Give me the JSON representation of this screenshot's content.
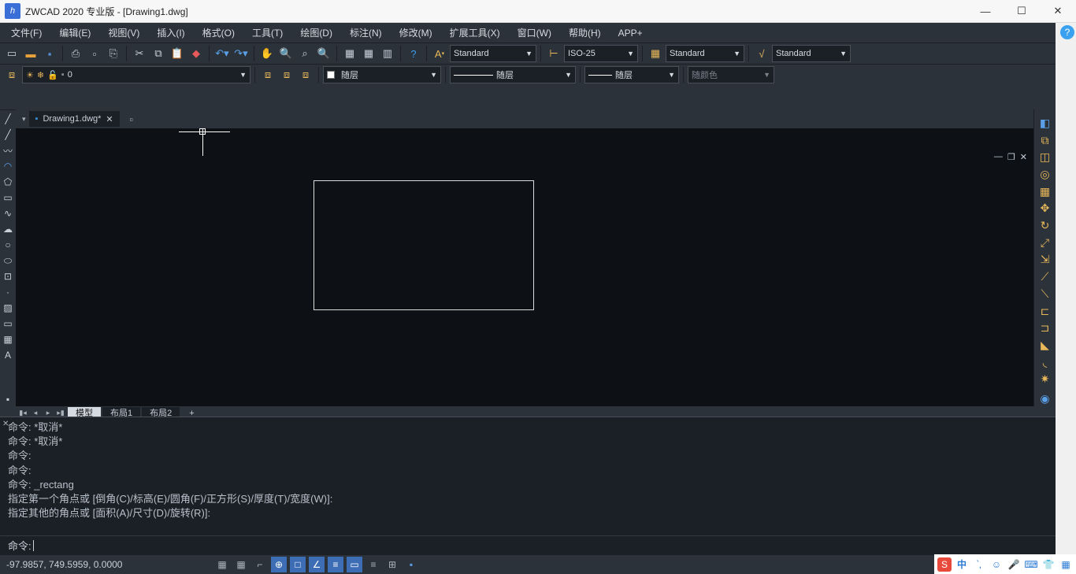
{
  "titlebar": {
    "app": "ZWCAD 2020 专业版 - [Drawing1.dwg]"
  },
  "menu": [
    "文件(F)",
    "编辑(E)",
    "视图(V)",
    "插入(I)",
    "格式(O)",
    "工具(T)",
    "绘图(D)",
    "标注(N)",
    "修改(M)",
    "扩展工具(X)",
    "窗口(W)",
    "帮助(H)",
    "APP+"
  ],
  "styles": {
    "text": "Standard",
    "dim": "ISO-25",
    "table": "Standard",
    "mleader": "Standard"
  },
  "layer": {
    "name": "0"
  },
  "props": {
    "bylayer1": "随层",
    "bylayer2": "随层",
    "bylayer3": "随层",
    "bycolor": "随颜色"
  },
  "doc_tab": "Drawing1.dwg*",
  "sheets": {
    "model": "模型",
    "layout1": "布局1",
    "layout2": "布局2",
    "add": "+"
  },
  "cmd_history": [
    "命令: *取消*",
    "命令: *取消*",
    "命令:",
    "命令:",
    "命令: _rectang",
    "指定第一个角点或 [倒角(C)/标高(E)/圆角(F)/正方形(S)/厚度(T)/宽度(W)]:",
    "指定其他的角点或 [面积(A)/尺寸(D)/旋转(R)]:"
  ],
  "cmd_prompt": "命令:",
  "status": {
    "coords": "-97.9857, 749.5959, 0.0000"
  },
  "ime": {
    "cn": "中",
    "punct": "՝,"
  }
}
